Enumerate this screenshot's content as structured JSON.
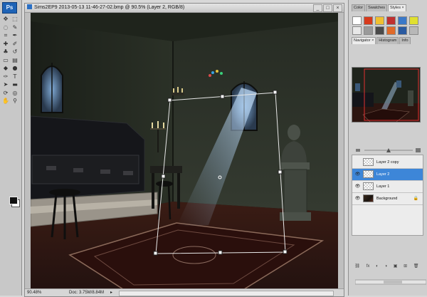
{
  "app": {
    "logo": "Ps"
  },
  "document": {
    "title": "Sims2EP9 2013-05-13 11-46-27-02.bmp @ 90.5% (Layer 2, RGB/8)",
    "zoom": "90.48%",
    "doc_size": "Doc: 3.75M/8.84M",
    "status_arrow": "▸",
    "window_buttons": {
      "minimize": "_",
      "maximize": "□",
      "close": "×"
    }
  },
  "tools": [
    {
      "name": "move-tool-icon",
      "glyph": "✥"
    },
    {
      "name": "marquee-tool-icon",
      "glyph": "⬚"
    },
    {
      "name": "lasso-tool-icon",
      "glyph": "◌"
    },
    {
      "name": "quick-select-tool-icon",
      "glyph": "✎"
    },
    {
      "name": "crop-tool-icon",
      "glyph": "⌗"
    },
    {
      "name": "eyedropper-tool-icon",
      "glyph": "✒"
    },
    {
      "name": "healing-brush-tool-icon",
      "glyph": "✚"
    },
    {
      "name": "brush-tool-icon",
      "glyph": "✐"
    },
    {
      "name": "clone-stamp-tool-icon",
      "glyph": "♣"
    },
    {
      "name": "history-brush-tool-icon",
      "glyph": "↺"
    },
    {
      "name": "eraser-tool-icon",
      "glyph": "▭"
    },
    {
      "name": "gradient-tool-icon",
      "glyph": "▤"
    },
    {
      "name": "blur-tool-icon",
      "glyph": "◆"
    },
    {
      "name": "dodge-tool-icon",
      "glyph": "●"
    },
    {
      "name": "pen-tool-icon",
      "glyph": "✑"
    },
    {
      "name": "type-tool-icon",
      "glyph": "T"
    },
    {
      "name": "path-select-tool-icon",
      "glyph": "➤"
    },
    {
      "name": "shape-tool-icon",
      "glyph": "▬"
    },
    {
      "name": "3d-rotate-tool-icon",
      "glyph": "⟳"
    },
    {
      "name": "3d-camera-tool-icon",
      "glyph": "◎"
    },
    {
      "name": "hand-tool-icon",
      "glyph": "✋"
    },
    {
      "name": "zoom-tool-icon",
      "glyph": "⚲"
    }
  ],
  "panels": {
    "top_tabs": [
      "Color",
      "Swatches",
      "Styles ×"
    ],
    "mid_tabs": [
      "Navigator ×",
      "Histogram",
      "Info"
    ],
    "style_swatches": [
      "#ffffff",
      "#d73a1c",
      "#f0c030",
      "#c03030",
      "#3a78c8",
      "#e0e030",
      "#e8e8e8",
      "#9a9a9a",
      "#4a4a4a",
      "#e06a2a",
      "#2a5aa0",
      "#b8b8b8"
    ]
  },
  "layers": [
    {
      "name": "Layer 2 copy",
      "visible": false,
      "thumb": "check",
      "selected": false,
      "locked": false
    },
    {
      "name": "Layer 2",
      "visible": true,
      "thumb": "check",
      "selected": true,
      "locked": false
    },
    {
      "name": "Layer 1",
      "visible": true,
      "thumb": "check",
      "selected": false,
      "locked": false
    },
    {
      "name": "Background",
      "visible": true,
      "thumb": "img",
      "selected": false,
      "locked": true
    }
  ],
  "layer_footer": [
    "⛓",
    "fx",
    "◐",
    "◑",
    "▣",
    "⊞",
    "🗑"
  ],
  "glyphs": {
    "eye": "👁",
    "lock": "🔒"
  }
}
